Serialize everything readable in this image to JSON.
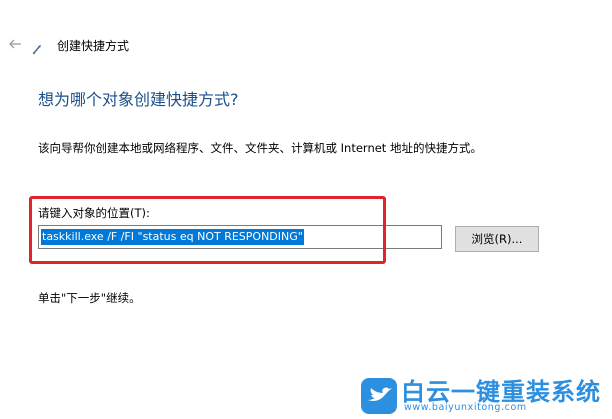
{
  "window": {
    "title": "创建快捷方式"
  },
  "main": {
    "heading": "想为哪个对象创建快捷方式?",
    "description": "该向导帮你创建本地或网络程序、文件、文件夹、计算机或 Internet 地址的快捷方式。",
    "location_label": "请键入对象的位置(T):",
    "location_value": "taskkill.exe /F /FI \"status eq NOT RESPONDING\"",
    "browse_label": "浏览(R)...",
    "hint": "单击\"下一步\"继续。"
  },
  "watermark": {
    "title": "白云一键重装系统",
    "url": "www.baiyunxitong.com"
  },
  "colors": {
    "heading": "#1a4f8b",
    "highlight_border": "#e0242c",
    "selection": "#0078d7",
    "watermark": "#2c8fe0"
  },
  "icons": [
    "back-arrow-icon",
    "wizard-icon",
    "bird-logo-icon"
  ]
}
